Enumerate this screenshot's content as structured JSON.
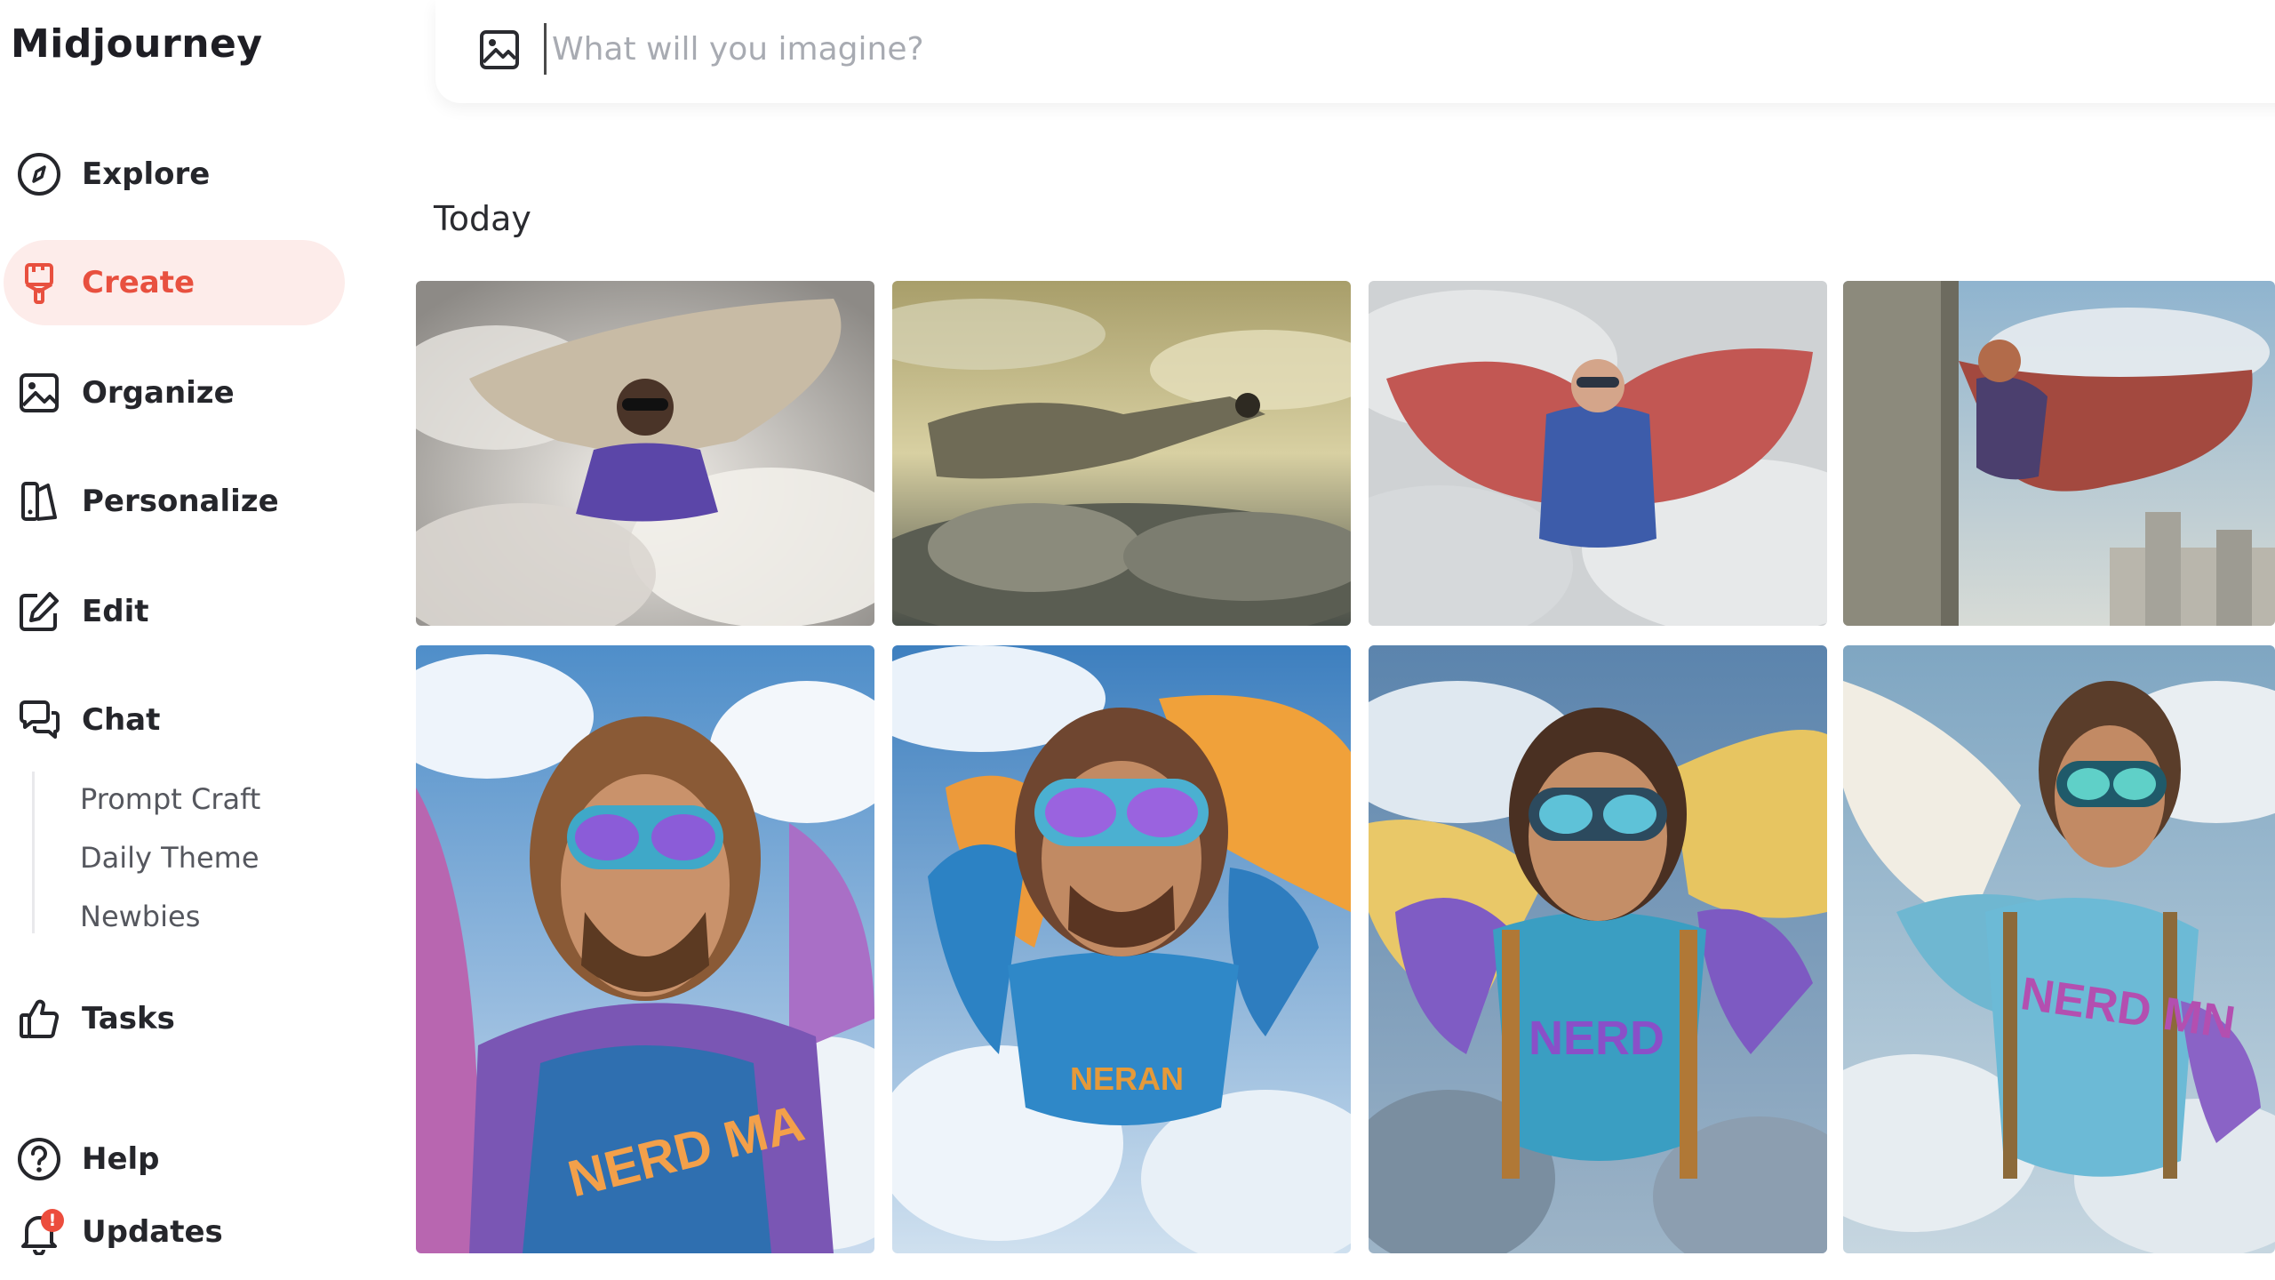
{
  "app": {
    "title": "Midjourney"
  },
  "sidebar": {
    "items": [
      {
        "label": "Explore",
        "icon": "compass-icon"
      },
      {
        "label": "Create",
        "icon": "brush-icon",
        "active": true
      },
      {
        "label": "Organize",
        "icon": "image-icon"
      },
      {
        "label": "Personalize",
        "icon": "personalize-icon"
      },
      {
        "label": "Edit",
        "icon": "edit-icon"
      },
      {
        "label": "Chat",
        "icon": "chat-icon"
      }
    ],
    "chat_rooms": [
      "Prompt Craft",
      "Daily Theme",
      "Newbies"
    ],
    "tasks": {
      "label": "Tasks",
      "icon": "thumbs-up-icon"
    },
    "help": {
      "label": "Help",
      "icon": "help-icon"
    },
    "updates": {
      "label": "Updates",
      "icon": "bell-icon",
      "badge": "!"
    }
  },
  "prompt": {
    "placeholder": "What will you imagine?",
    "icon": "image-upload-icon"
  },
  "gallery": {
    "section": "Today"
  },
  "colors": {
    "accent": "#e8503f",
    "active_bg": "#fdecea"
  }
}
